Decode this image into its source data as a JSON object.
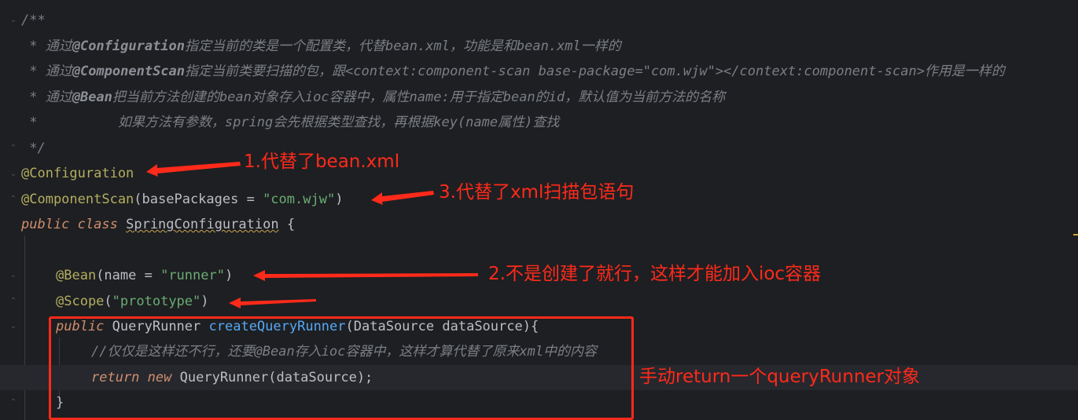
{
  "code": {
    "comment_open": "/**",
    "comment_lines": [
      {
        "prefix": " * 通过",
        "kw": "@Configuration",
        "rest": "指定当前的类是一个配置类，代替bean.xml，功能是和bean.xml一样的"
      },
      {
        "prefix": " * 通过",
        "kw": "@ComponentScan",
        "rest": "指定当前类要扫描的包，跟<context:component-scan base-package=\"com.wjw\"></context:component-scan>作用是一样的"
      },
      {
        "prefix": " * 通过",
        "kw": "@Bean",
        "rest": "把当前方法创建的bean对象存入ioc容器中，属性name:用于指定bean的id，默认值为当前方法的名称"
      },
      {
        "prefix": " *          ",
        "kw": "",
        "rest": "如果方法有参数，spring会先根据类型查找，再根据key(name属性)查找"
      }
    ],
    "comment_close": " */",
    "annotation_configuration": "@Configuration",
    "annotation_component_scan": "@ComponentScan",
    "component_scan_params": "(basePackages = ",
    "component_scan_value": "\"com.wjw\"",
    "component_scan_close": ")",
    "kw_public": "public",
    "kw_class": "class",
    "class_name": "SpringConfiguration",
    "open_brace": " {",
    "annotation_bean": "@Bean",
    "bean_params": "(name = ",
    "bean_value": "\"runner\"",
    "bean_close": ")",
    "annotation_scope": "@Scope",
    "scope_open": "(",
    "scope_value": "\"prototype\"",
    "scope_close": ")",
    "return_type": "QueryRunner",
    "method_name": "createQueryRunner",
    "param_type": "DataSource",
    "param_name": "dataSource",
    "method_sig_close": "){",
    "inline_comment": "//仅仅是这样还不行，还要@Bean存入ioc容器中，这样才算代替了原来xml中的内容",
    "kw_return": "return",
    "kw_new": "new",
    "new_type": "QueryRunner",
    "new_args": "(dataSource);",
    "close_brace": "}"
  },
  "annotations": {
    "note1": "1.代替了bean.xml",
    "note2": "2.不是创建了就行，这样才能加入ioc容器",
    "note3": "3.代替了xml扫描包语句",
    "note4": "手动return一个queryRunner对象"
  },
  "colors": {
    "background": "#1e1f22",
    "annotation_red": "#ff2a1a",
    "comment": "#7a7e85",
    "keyword": "#cf8e6d",
    "string": "#6aab73",
    "annotation": "#b3ae60",
    "method": "#56a8f5"
  }
}
